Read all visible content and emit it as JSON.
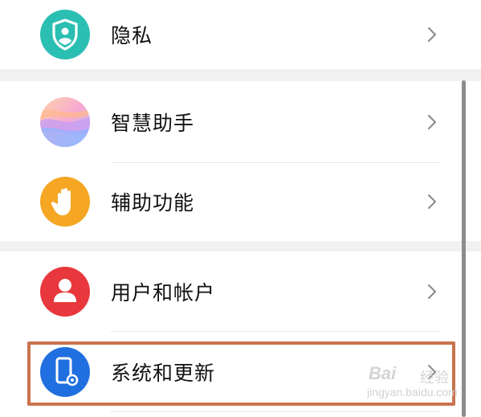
{
  "settings": {
    "items": [
      {
        "label": "隐私",
        "icon": "privacy-shield-icon",
        "icon_color": "#2bbfb3"
      },
      {
        "label": "智慧助手",
        "icon": "smart-assistant-icon",
        "icon_color": "#c9a5f0"
      },
      {
        "label": "辅助功能",
        "icon": "hand-icon",
        "icon_color": "#f5a623"
      },
      {
        "label": "用户和帐户",
        "icon": "user-icon",
        "icon_color": "#e8383d"
      },
      {
        "label": "系统和更新",
        "icon": "phone-gear-icon",
        "icon_color": "#1f6fe0"
      }
    ]
  },
  "highlight_color": "#c9734e",
  "watermark": {
    "brand": "Bai",
    "cn": "经验",
    "url": "jingyan.baidu.com"
  }
}
